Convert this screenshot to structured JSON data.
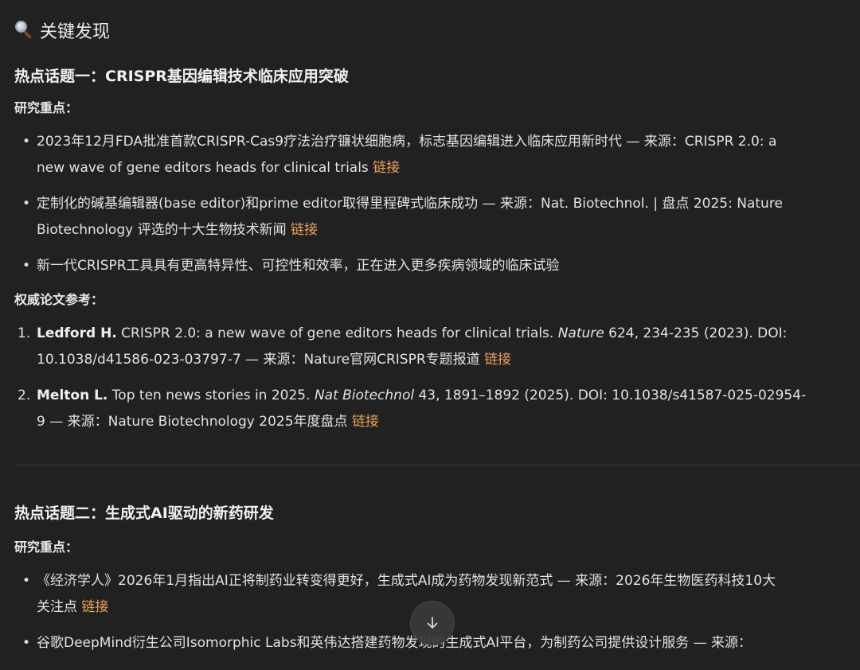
{
  "heading": {
    "icon": "magnifying-glass-icon",
    "title": "关键发现"
  },
  "topic1": {
    "title": "热点话题一：CRISPR基因编辑技术临床应用突破",
    "focus_label": "研究重点：",
    "points": [
      {
        "line1": "2023年12月FDA批准首款CRISPR-Cas9疗法治疗镰状细胞病，标志基因编辑进入临床应用新时代 — 来源：CRISPR 2.0: a",
        "line2": "new wave of gene editors heads for clinical trials",
        "link": "链接"
      },
      {
        "line1": "定制化的碱基编辑器(base editor)和prime editor取得里程碑式临床成功 — 来源：Nat. Biotechnol. | 盘点 2025: Nature",
        "line2": "Biotechnology 评选的十大生物技术新闻",
        "link": "链接"
      },
      {
        "line1": "新一代CRISPR工具具有更高特异性、可控性和效率，正在进入更多疾病领域的临床试验"
      }
    ],
    "refs_label": "权威论文参考：",
    "refs": [
      {
        "num": "1.",
        "author": "Ledford H.",
        "text1": " CRISPR 2.0: a new wave of gene editors heads for clinical trials. ",
        "journal": "Nature",
        "text2": " 624, 234-235 (2023). DOI:",
        "line2": "10.1038/d41586-023-03797-7 — 来源：Nature官网CRISPR专题报道",
        "link": "链接"
      },
      {
        "num": "2.",
        "author": "Melton L.",
        "text1": " Top ten news stories in 2025. ",
        "journal": "Nat Biotechnol",
        "text2": " 43, 1891–1892 (2025). DOI: 10.1038/s41587-025-02954-",
        "line2": "9 — 来源：Nature Biotechnology 2025年度盘点",
        "link": "链接"
      }
    ]
  },
  "topic2": {
    "title": "热点话题二：生成式AI驱动的新药研发",
    "focus_label": "研究重点：",
    "points": [
      {
        "line1": "《经济学人》2026年1月指出AI正将制药业转变得更好，生成式AI成为药物发现新范式 — 来源：2026年生物医药科技10大",
        "line2": "关注点",
        "link": "链接"
      },
      {
        "line1": "谷歌DeepMind衍生公司Isomorphic Labs和英伟达搭建药物发现的生成式AI平台，为制药公司提供设计服务 — 来源："
      }
    ]
  },
  "scroll_button": {
    "icon": "arrow-down-icon"
  }
}
